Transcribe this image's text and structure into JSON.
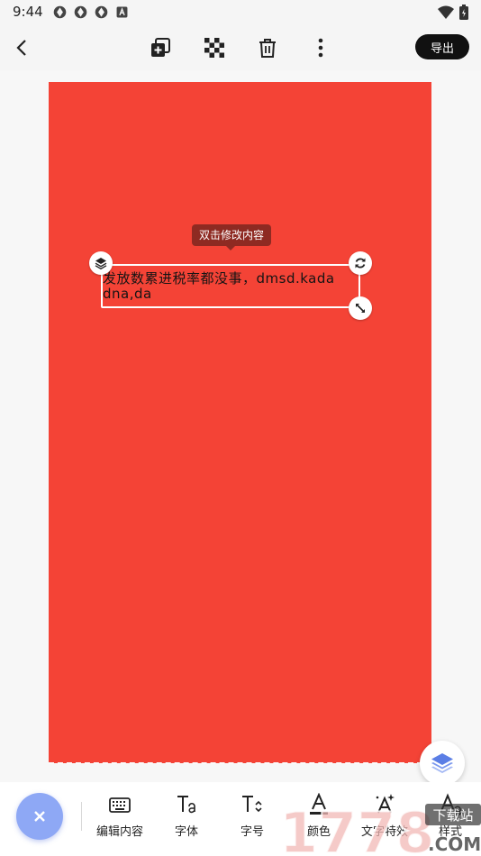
{
  "status_bar": {
    "time": "9:44"
  },
  "toolbar": {
    "export_label": "导出"
  },
  "canvas": {
    "background_color": "#f44336",
    "tooltip": "双击修改内容",
    "text_content": "发放数累进税率都没事，dmsd.kada\ndna,da"
  },
  "bottom_tools": [
    {
      "label": "编辑内容",
      "icon": "keyboard-icon"
    },
    {
      "label": "字体",
      "icon": "font-icon"
    },
    {
      "label": "字号",
      "icon": "font-size-icon"
    },
    {
      "label": "颜色",
      "icon": "text-color-icon"
    },
    {
      "label": "文字特效",
      "icon": "text-effect-icon"
    },
    {
      "label": "样式",
      "icon": "text-style-icon"
    }
  ],
  "watermark": {
    "text": "1778",
    "site": "下载站",
    "domain": ".COM"
  },
  "colors": {
    "accent": "#8ea8f5",
    "layers_icon": "#5b7ee5",
    "export_bg": "#111111"
  }
}
